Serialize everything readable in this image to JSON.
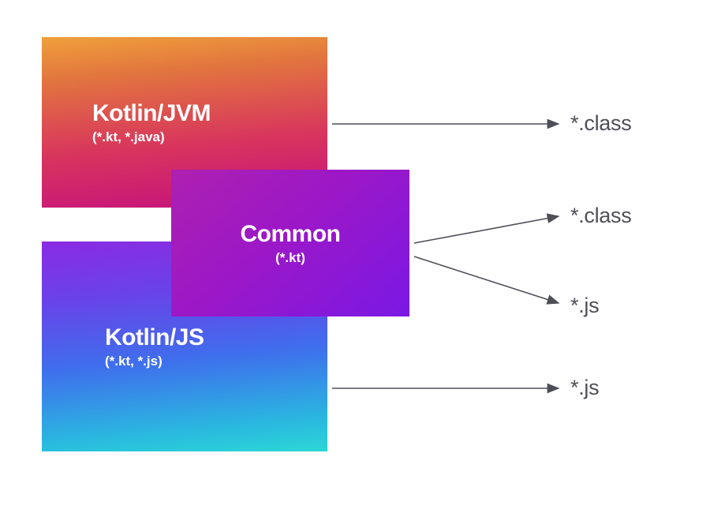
{
  "boxes": {
    "jvm": {
      "title": "Kotlin/JVM",
      "subtitle": "(*.kt, *.java)"
    },
    "common": {
      "title": "Common",
      "subtitle": "(*.kt)"
    },
    "js": {
      "title": "Kotlin/JS",
      "subtitle": "(*.kt, *.js)"
    }
  },
  "outputs": {
    "jvm": "*.class",
    "common_class": "*.class",
    "common_js": "*.js",
    "js": "*.js"
  },
  "colors": {
    "text_output": "#4e4e57",
    "arrow": "#4e4e57",
    "jvm_gradient": [
      "#f0a03b",
      "#d8345e",
      "#c4117e"
    ],
    "js_gradient": [
      "#8a2be2",
      "#3f6eed",
      "#2bd7d6"
    ],
    "common_gradient": [
      "#ad20b0",
      "#7a18e5"
    ]
  },
  "diagram": {
    "description": "Kotlin multiplatform compilation targets: JVM and JS platform modules share a Common module; JVM compiles to .class, JS compiles to .js, Common compiles to both.",
    "arrows": [
      {
        "from": "jvm",
        "to": "*.class"
      },
      {
        "from": "common",
        "to": "*.class"
      },
      {
        "from": "common",
        "to": "*.js"
      },
      {
        "from": "js",
        "to": "*.js"
      }
    ]
  }
}
